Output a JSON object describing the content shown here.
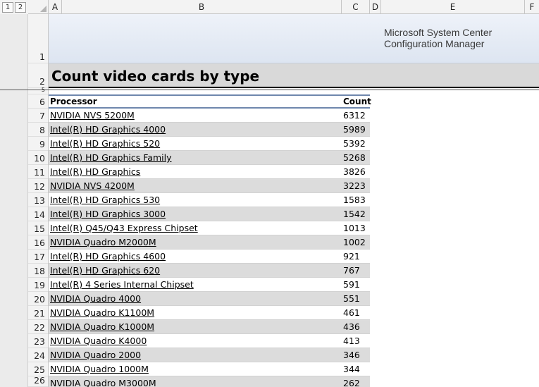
{
  "outline": {
    "levels": [
      "1",
      "2"
    ]
  },
  "columns": [
    "A",
    "B",
    "C",
    "D",
    "E",
    "F"
  ],
  "rows": [
    "1",
    "2",
    "5",
    "6",
    "7",
    "8",
    "9",
    "10",
    "11",
    "12",
    "13",
    "14",
    "15",
    "16",
    "17",
    "18",
    "19",
    "20",
    "21",
    "22",
    "23",
    "24",
    "25",
    "26"
  ],
  "banner": {
    "logo_line1": "Microsoft System Center",
    "logo_line2": "Configuration Manager"
  },
  "report": {
    "title": "Count video cards by type"
  },
  "table": {
    "headers": {
      "processor": "Processor",
      "count": "Count"
    },
    "rows": [
      {
        "processor": "NVIDIA NVS 5200M",
        "count": "6312"
      },
      {
        "processor": "Intel(R) HD Graphics 4000",
        "count": "5989"
      },
      {
        "processor": "Intel(R) HD Graphics 520",
        "count": "5392"
      },
      {
        "processor": "Intel(R) HD Graphics Family",
        "count": "5268"
      },
      {
        "processor": "Intel(R) HD Graphics",
        "count": "3826"
      },
      {
        "processor": "NVIDIA NVS 4200M",
        "count": "3223"
      },
      {
        "processor": "Intel(R) HD Graphics 530",
        "count": "1583"
      },
      {
        "processor": "Intel(R) HD Graphics 3000",
        "count": "1542"
      },
      {
        "processor": "Intel(R) Q45/Q43 Express Chipset",
        "count": "1013"
      },
      {
        "processor": "NVIDIA Quadro M2000M",
        "count": "1002"
      },
      {
        "processor": "Intel(R) HD Graphics 4600",
        "count": "921"
      },
      {
        "processor": "Intel(R) HD Graphics 620",
        "count": "767"
      },
      {
        "processor": "Intel(R) 4 Series Internal Chipset",
        "count": "591"
      },
      {
        "processor": "NVIDIA Quadro 4000",
        "count": "551"
      },
      {
        "processor": "NVIDIA Quadro K1100M",
        "count": "461"
      },
      {
        "processor": "NVIDIA Quadro K1000M",
        "count": "436"
      },
      {
        "processor": "NVIDIA Quadro K4000",
        "count": "413"
      },
      {
        "processor": "NVIDIA Quadro 2000",
        "count": "346"
      },
      {
        "processor": "NVIDIA Quadro 1000M",
        "count": "344"
      },
      {
        "processor": "NVIDIA Quadro M3000M",
        "count": "262"
      }
    ]
  }
}
